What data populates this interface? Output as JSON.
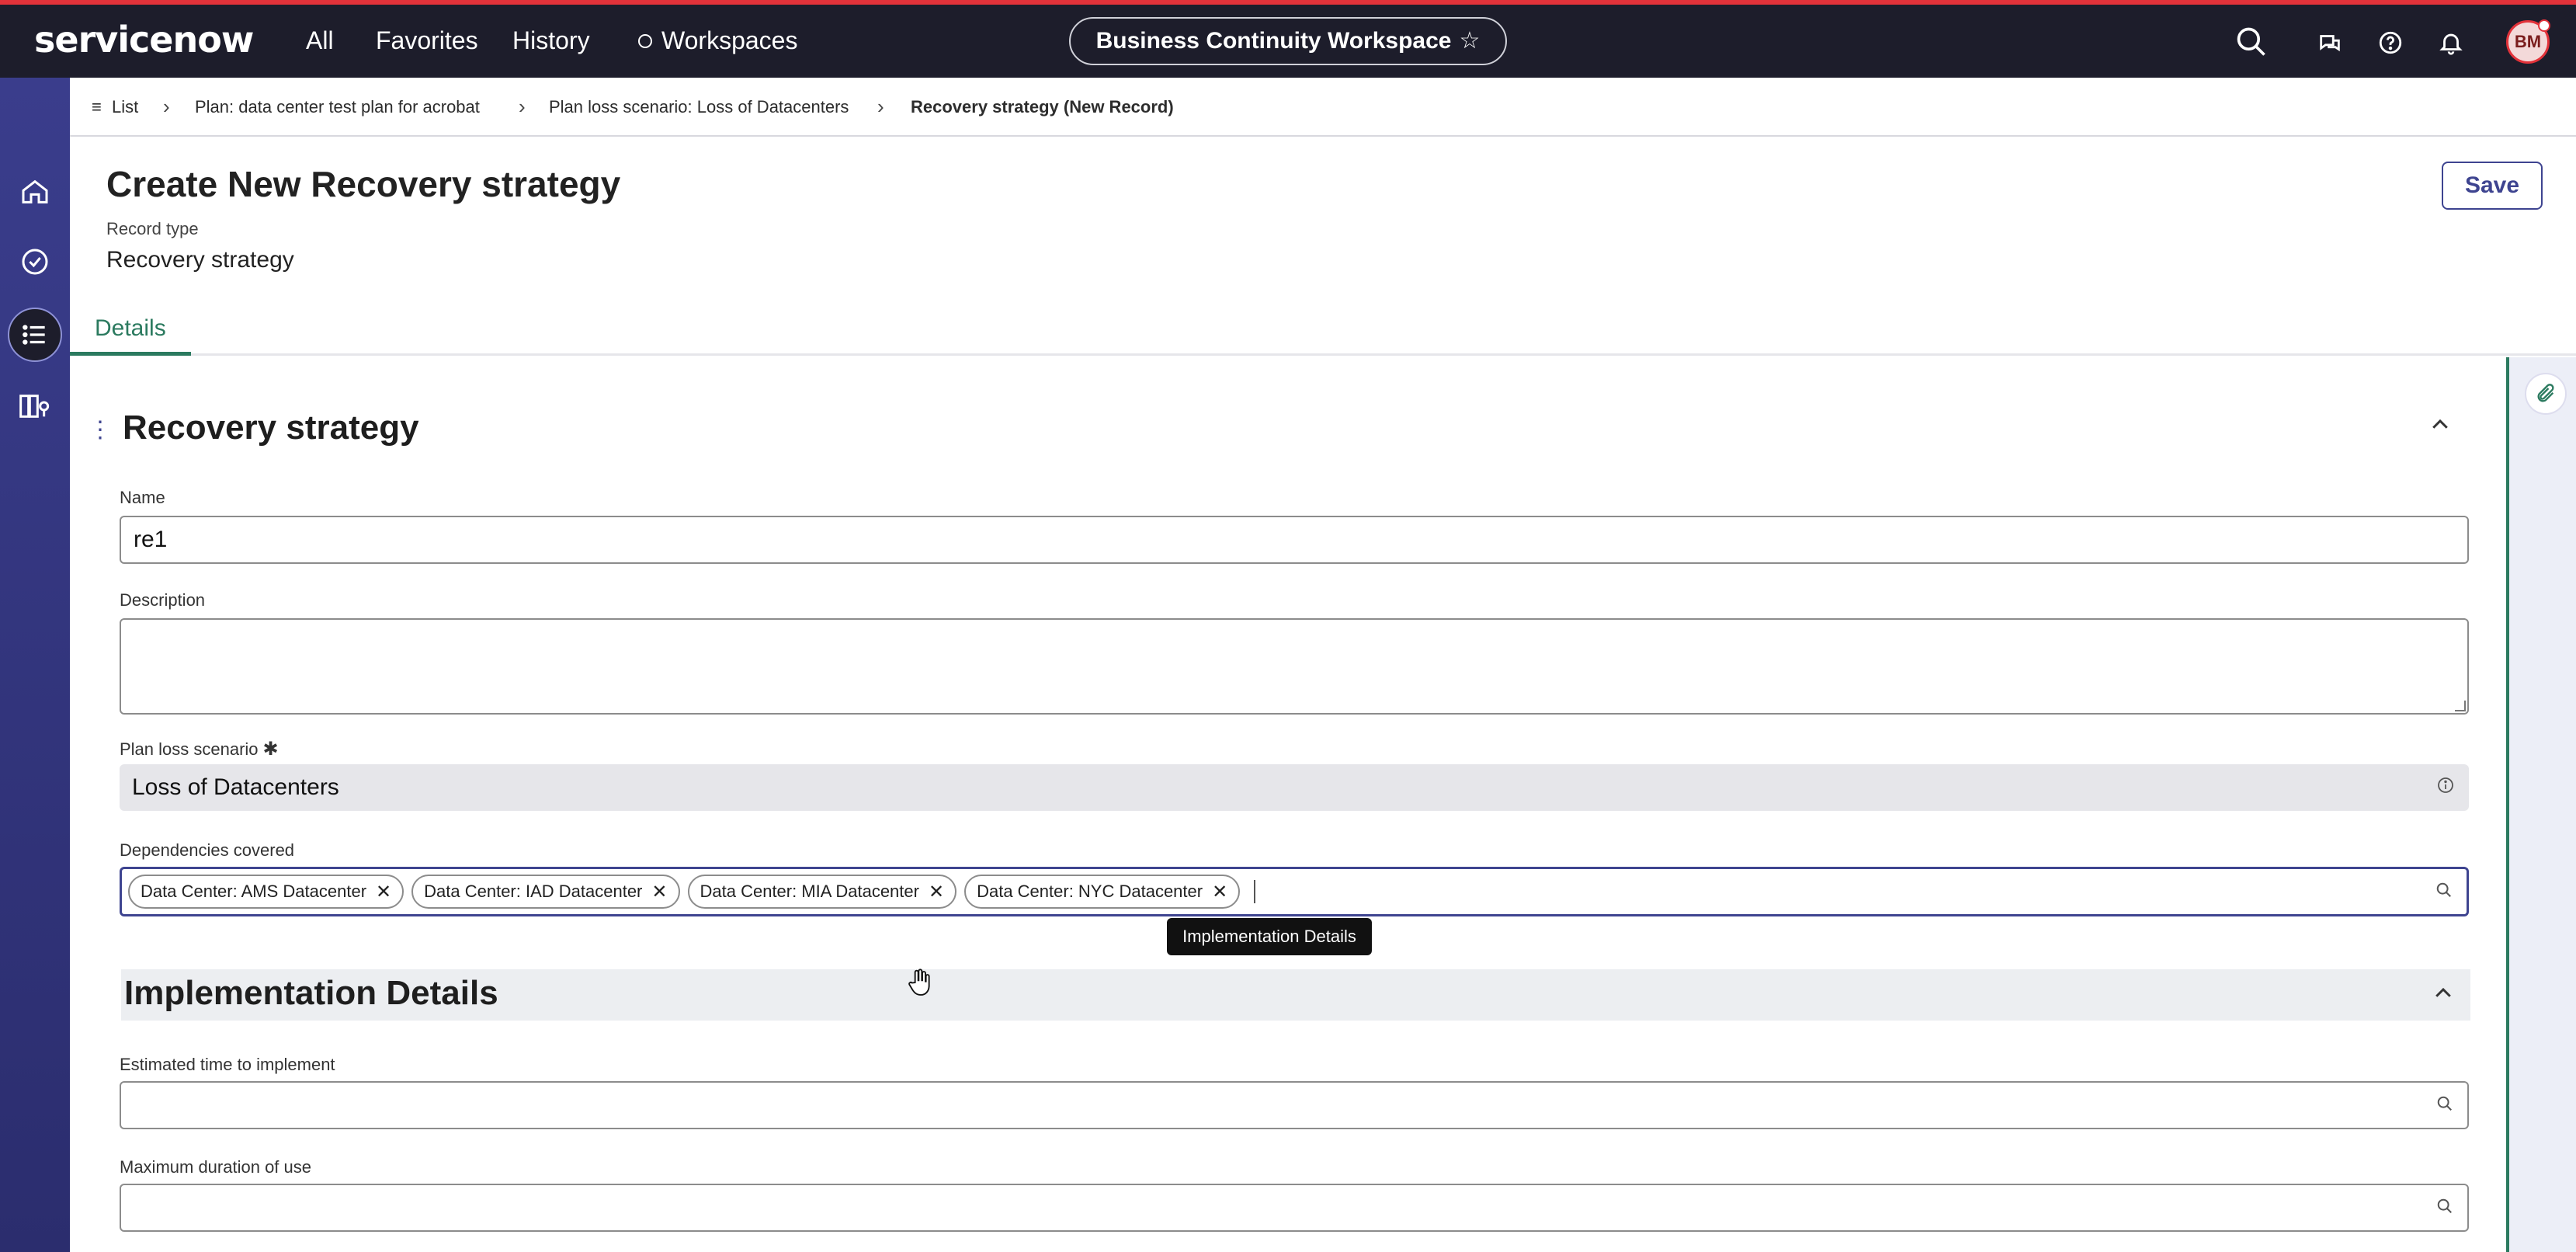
{
  "topbar": {
    "logo": "servicenow",
    "nav": [
      "All",
      "Favorites",
      "History",
      "Workspaces"
    ],
    "workspace_title": "Business Continuity Workspace",
    "avatar_initials": "BM",
    "accent_color": "#e2323a",
    "bg_color": "#1d1d2b"
  },
  "leftrail": {
    "items": [
      "home-icon",
      "check-circle-icon",
      "list-icon",
      "book-icon"
    ],
    "active": "list-icon"
  },
  "breadcrumb": {
    "list": "List",
    "plan": "Plan: data center test plan for acrobat",
    "scenario": "Plan loss scenario: Loss of Datacenters",
    "current": "Recovery strategy (New Record)"
  },
  "header": {
    "title": "Create New Recovery strategy",
    "record_type_label": "Record type",
    "record_type_value": "Recovery strategy",
    "save_label": "Save",
    "tab": "Details"
  },
  "section": {
    "title": "Recovery strategy",
    "name_label": "Name",
    "name_value": "re1",
    "description_label": "Description",
    "description_value": "",
    "scenario_label": "Plan loss scenario",
    "scenario_required": "✱",
    "scenario_value": "Loss of Datacenters",
    "dependencies_label": "Dependencies covered",
    "dependencies": [
      "Data Center: AMS Datacenter",
      "Data Center: IAD Datacenter",
      "Data Center: MIA Datacenter",
      "Data Center: NYC Datacenter"
    ]
  },
  "tooltip": "Implementation Details",
  "implementation": {
    "title": "Implementation Details",
    "est_time_label": "Estimated time to implement",
    "max_duration_label": "Maximum duration of use"
  }
}
